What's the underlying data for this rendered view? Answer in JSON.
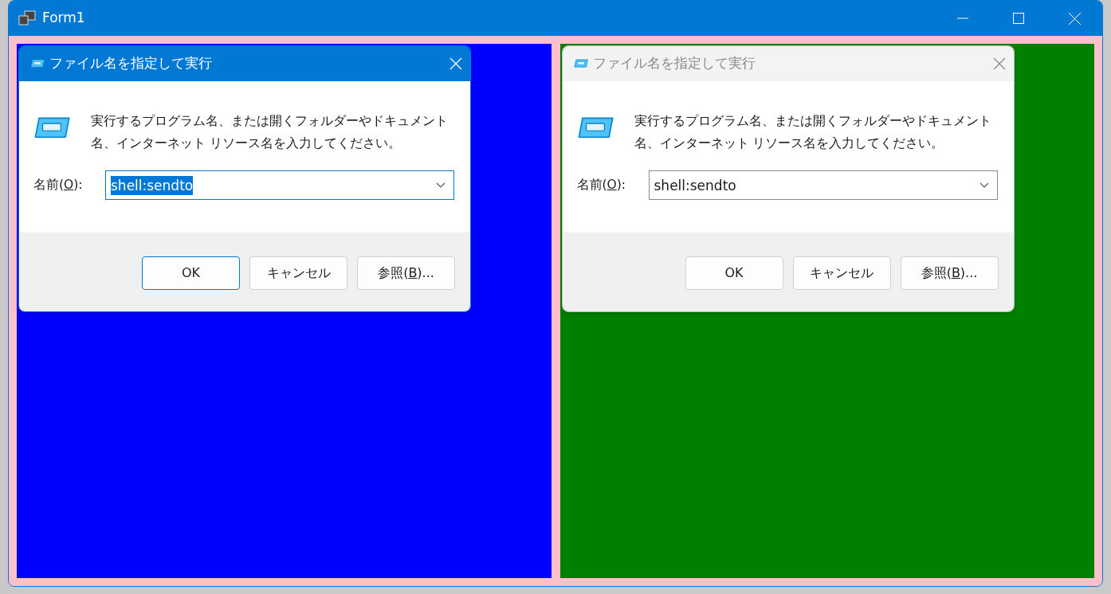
{
  "window": {
    "title": "Form1"
  },
  "panels": [
    {
      "color": "#0000ff",
      "dialog": {
        "title": "ファイル名を指定して実行",
        "active": true,
        "message": "実行するプログラム名、または開くフォルダーやドキュメント名、インターネット リソース名を入力してください。",
        "label_parts": [
          "名前(",
          "O",
          "):"
        ],
        "value": "shell:sendto",
        "value_selected": true,
        "buttons": [
          {
            "label_parts": [
              "OK"
            ],
            "default": true
          },
          {
            "label_parts": [
              "キャンセル"
            ],
            "default": false
          },
          {
            "label_parts": [
              "参照(",
              "B",
              ")..."
            ],
            "default": false
          }
        ]
      }
    },
    {
      "color": "#008000",
      "dialog": {
        "title": "ファイル名を指定して実行",
        "active": false,
        "message": "実行するプログラム名、または開くフォルダーやドキュメント名、インターネット リソース名を入力してください。",
        "label_parts": [
          "名前(",
          "O",
          "):"
        ],
        "value": "shell:sendto",
        "value_selected": false,
        "buttons": [
          {
            "label_parts": [
              "OK"
            ],
            "default": false
          },
          {
            "label_parts": [
              "キャンセル"
            ],
            "default": false
          },
          {
            "label_parts": [
              "参照(",
              "B",
              ")..."
            ],
            "default": false
          }
        ]
      }
    }
  ]
}
